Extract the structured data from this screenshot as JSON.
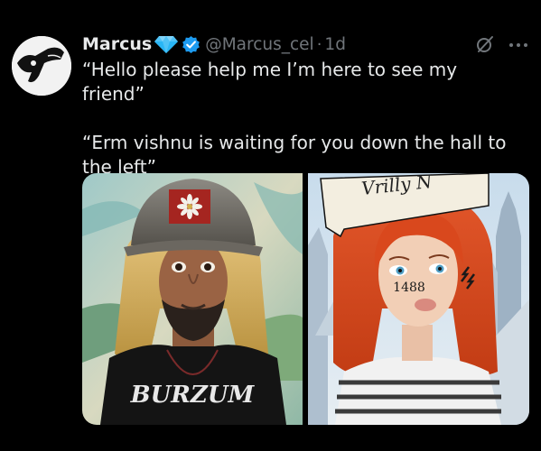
{
  "tweet": {
    "author_name": "Marcus",
    "handle": "@Marcus_cel",
    "separator": "·",
    "time": "1d",
    "lines": [
      "“Hello please help me I’m here to see my friend”",
      "“Erm vishnu is waiting for you down the hall to the left”"
    ]
  },
  "media": {
    "left_shirt_text": "BURZUM",
    "right_sign_text": "Vrilly N",
    "right_cheek_text": "1488"
  },
  "colors": {
    "background": "#000000",
    "text": "#e7e9ea",
    "secondary": "#71767b",
    "verified": "#1d9bf0",
    "diamond": "#4fc3f7"
  },
  "icons": [
    "avatar",
    "diamond-emoji-icon",
    "verified-badge-icon",
    "grok-icon",
    "more-icon"
  ]
}
